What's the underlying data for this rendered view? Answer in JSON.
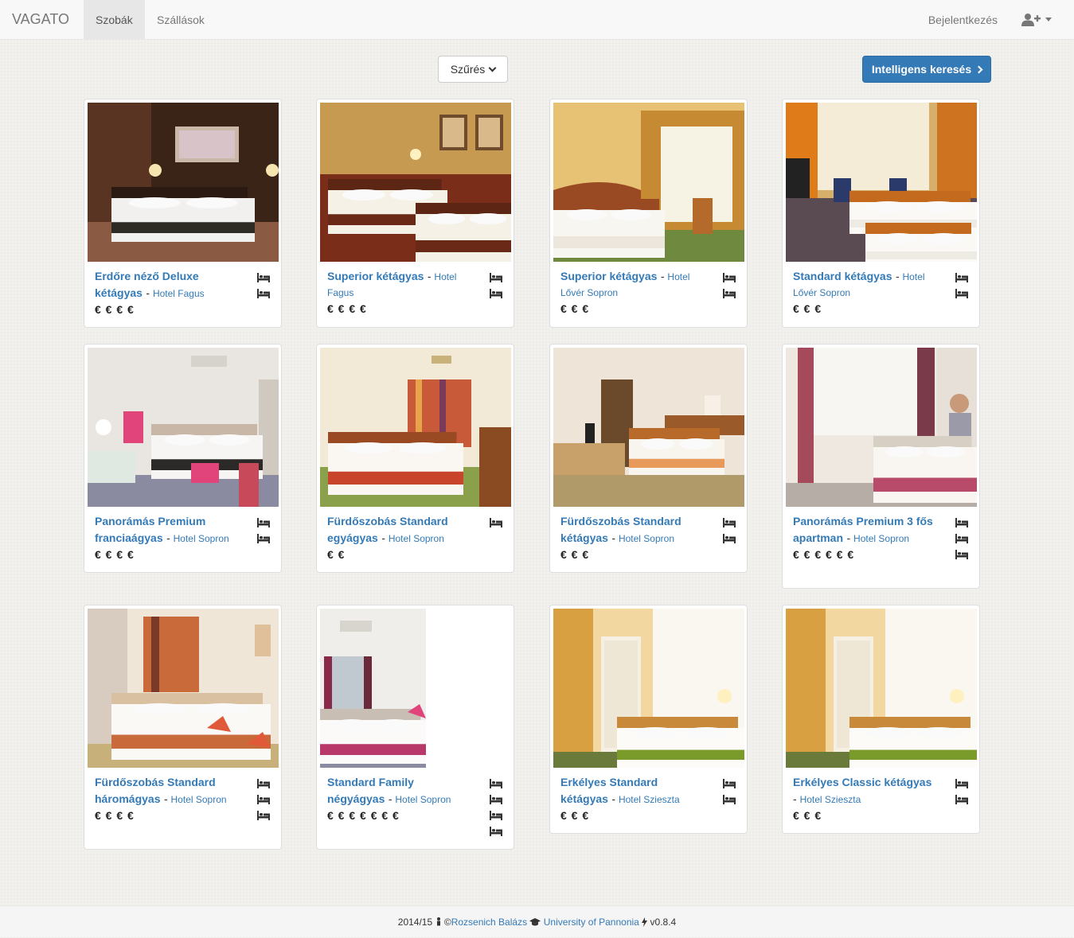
{
  "navbar": {
    "brand": "VAGATO",
    "tabs": [
      {
        "label": "Szobák",
        "active": true
      },
      {
        "label": "Szállások",
        "active": false
      }
    ],
    "login_label": "Bejelentkezés",
    "user_menu_icon": "user-plus-icon"
  },
  "toolbar": {
    "filter_label": "Szűrés",
    "smart_search_label": "Intelligens keresés"
  },
  "rooms": [
    {
      "name": "Erdőre néző Deluxe kétágyas",
      "hotel": "Hotel Fagus",
      "price": "€ € € €",
      "beds": 2
    },
    {
      "name": "Superior kétágyas",
      "hotel": "Hotel Fagus",
      "price": "€ € € €",
      "beds": 2
    },
    {
      "name": "Superior kétágyas",
      "hotel": "Hotel Lővér Sopron",
      "price": "€ € €",
      "beds": 2
    },
    {
      "name": "Standard kétágyas",
      "hotel": "Hotel Lővér Sopron",
      "price": "€ € €",
      "beds": 2
    },
    {
      "name": "Panorámás Premium franciaágyas",
      "hotel": "Hotel Sopron",
      "price": "€ € € €",
      "beds": 2
    },
    {
      "name": "Fürdőszobás Standard egyágyas",
      "hotel": "Hotel Sopron",
      "price": "€ €",
      "beds": 1
    },
    {
      "name": "Fürdőszobás Standard kétágyas",
      "hotel": "Hotel Sopron",
      "price": "€ € €",
      "beds": 2
    },
    {
      "name": "Panorámás Premium 3 fős apartman",
      "hotel": "Hotel Sopron",
      "price": "€ € € € € €",
      "beds": 3
    },
    {
      "name": "Fürdőszobás Standard háromágyas",
      "hotel": "Hotel Sopron",
      "price": "€ € € €",
      "beds": 3
    },
    {
      "name": "Standard Family négyágyas",
      "hotel": "Hotel Sopron",
      "price": "€ € € € € € €",
      "beds": 4
    },
    {
      "name": "Erkélyes Standard kétágyas",
      "hotel": "Hotel Szieszta",
      "price": "€ € €",
      "beds": 2
    },
    {
      "name": "Erkélyes Classic kétágyas",
      "hotel": "Hotel Szieszta",
      "price": "€ € €",
      "beds": 2
    }
  ],
  "footer": {
    "year": "2014/15",
    "copyright": "©",
    "author": "Rozsenich Balázs",
    "university": "University of Pannonia",
    "version": "v0.8.4"
  },
  "colors": {
    "link": "#337ab7",
    "primary_button": "#337ab7",
    "navbar_bg": "#f8f8f8",
    "page_bg": "#f1f0ec"
  }
}
